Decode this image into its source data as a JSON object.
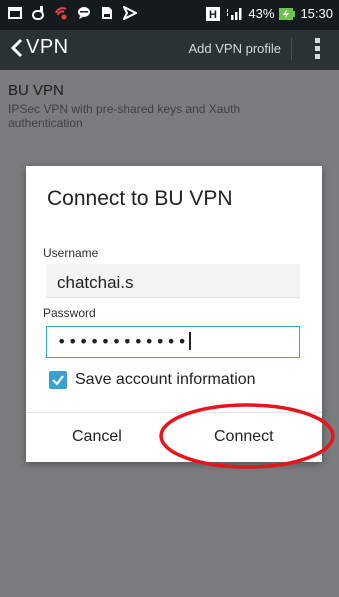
{
  "status_bar": {
    "icons_left": [
      "message-icon",
      "phone-icon",
      "signal-alert-icon",
      "chat-icon",
      "document-icon",
      "send-icon"
    ],
    "battery": "43%",
    "time": "15:30",
    "network": "H"
  },
  "action_bar": {
    "title": "VPN",
    "add_profile": "Add VPN profile"
  },
  "vpn_item": {
    "title": "BU VPN",
    "subtitle": "IPSec VPN with pre-shared keys and Xauth authentication"
  },
  "dialog": {
    "title": "Connect to BU VPN",
    "username_label": "Username",
    "username_value": "chatchai.s",
    "password_label": "Password",
    "password_mask": "••••••••••••",
    "save_label": "Save account information",
    "save_checked": true,
    "cancel_label": "Cancel",
    "connect_label": "Connect"
  },
  "colors": {
    "accent": "#39a0d3",
    "annotation": "#e8141c"
  }
}
